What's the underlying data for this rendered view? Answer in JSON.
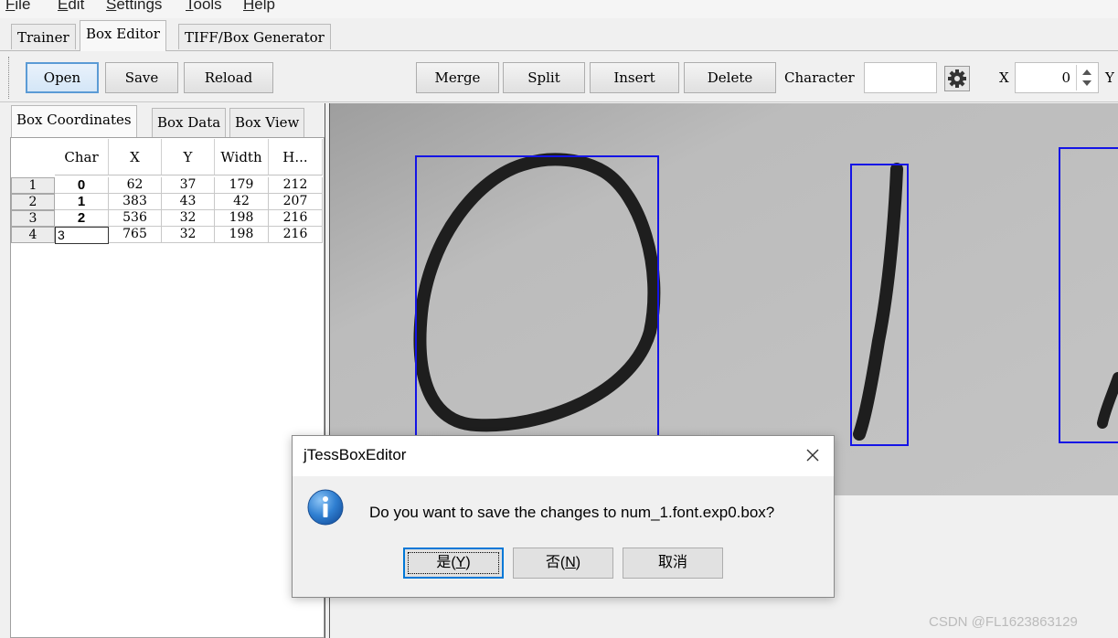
{
  "menu": {
    "file": {
      "mnemonic": "F",
      "rest": "ile"
    },
    "edit": {
      "mnemonic": "E",
      "rest": "dit"
    },
    "settings": {
      "mnemonic": "S",
      "rest": "ettings"
    },
    "tools": {
      "mnemonic": "T",
      "rest": "ools"
    },
    "help": {
      "mnemonic": "H",
      "rest": "elp"
    }
  },
  "main_tabs": {
    "trainer": "Trainer",
    "box_editor": "Box Editor",
    "tiff_box_generator": "TIFF/Box Generator"
  },
  "toolbar": {
    "open": "Open",
    "save": "Save",
    "reload": "Reload",
    "merge": "Merge",
    "split": "Split",
    "insert": "Insert",
    "delete": "Delete",
    "character_label": "Character",
    "character_value": "",
    "x_label": "X",
    "x_value": "0",
    "y_label": "Y"
  },
  "left_tabs": {
    "box_coordinates": "Box Coordinates",
    "box_data": "Box Data",
    "box_view": "Box View"
  },
  "table": {
    "headers": {
      "char": "Char",
      "x": "X",
      "y": "Y",
      "width": "Width",
      "height": "H..."
    },
    "rows": [
      {
        "num": "1",
        "char": "0",
        "x": "62",
        "y": "37",
        "width": "179",
        "height": "212"
      },
      {
        "num": "2",
        "char": "1",
        "x": "383",
        "y": "43",
        "width": "42",
        "height": "207"
      },
      {
        "num": "3",
        "char": "2",
        "x": "536",
        "y": "32",
        "width": "198",
        "height": "216"
      },
      {
        "num": "4",
        "char": "3",
        "x": "765",
        "y": "32",
        "width": "198",
        "height": "216"
      }
    ]
  },
  "dialog": {
    "title": "jTessBoxEditor",
    "message": "Do you want to save the changes to num_1.font.exp0.box?",
    "yes_prefix": "是(",
    "yes_mnemonic": "Y",
    "yes_suffix": ")",
    "no_prefix": "否(",
    "no_mnemonic": "N",
    "no_suffix": ")",
    "cancel": "取消"
  },
  "watermark": "CSDN @FL1623863129",
  "colors": {
    "box_outline": "#1414e6",
    "primary_button_border": "#5b9bd5",
    "default_button_border": "#0078d7"
  }
}
